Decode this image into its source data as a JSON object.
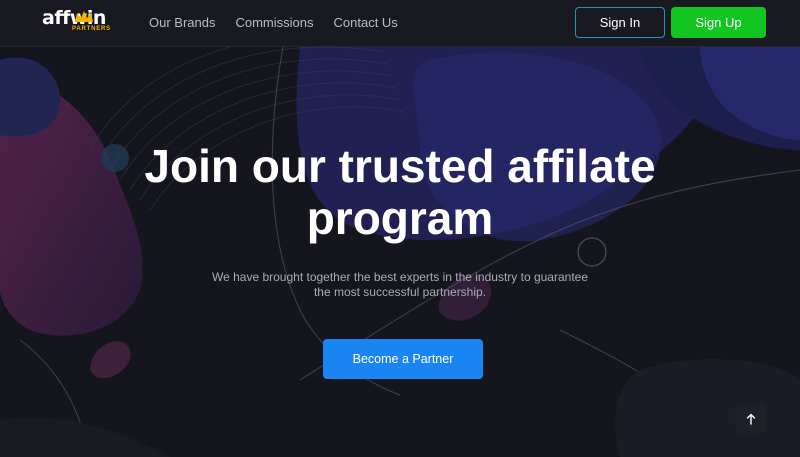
{
  "header": {
    "logo": {
      "main": "affwin",
      "sub": "PARTNERS"
    },
    "nav": [
      {
        "label": "Our Brands"
      },
      {
        "label": "Commissions"
      },
      {
        "label": "Contact Us"
      }
    ],
    "sign_in": "Sign In",
    "sign_up": "Sign Up"
  },
  "hero": {
    "title_line1": "Join our trusted affilate",
    "title_line2": "program",
    "subtitle_line1": "We have brought together the best experts in the industry to guarantee",
    "subtitle_line2": "the most successful partnership.",
    "cta": "Become a Partner"
  },
  "colors": {
    "background": "#14151c",
    "header": "#191a21",
    "sign_up": "#13c520",
    "cta": "#1a84f2",
    "logo_accent": "#f2b400"
  },
  "icons": {
    "scroll_top": "arrow-up-icon"
  }
}
